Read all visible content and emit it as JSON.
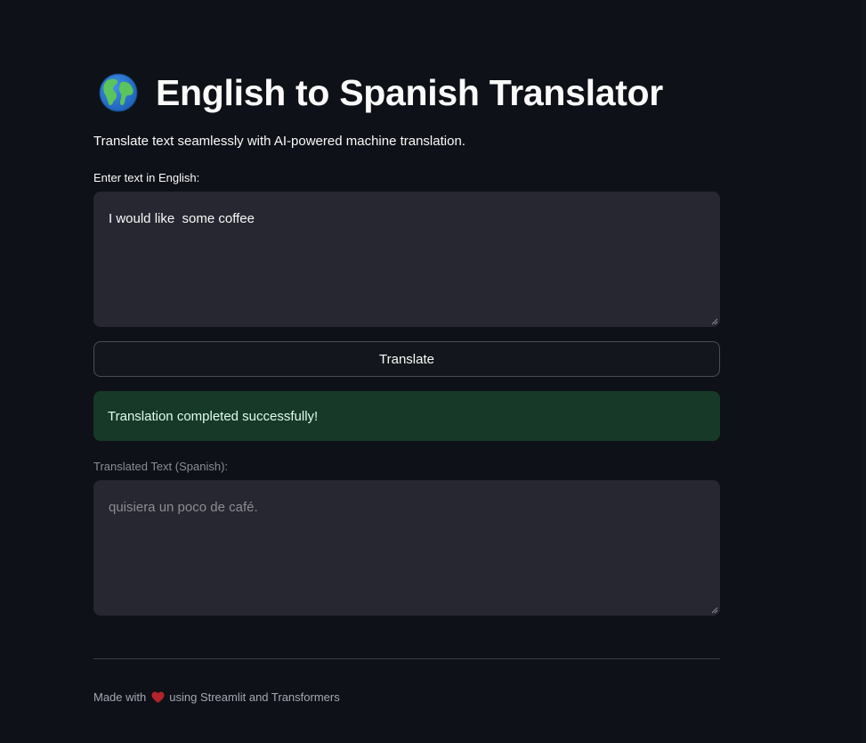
{
  "header": {
    "icon": "globe-icon",
    "title": "English to Spanish Translator",
    "subtitle": "Translate text seamlessly with AI-powered machine translation."
  },
  "input": {
    "label": "Enter text in English:",
    "value": "I would like  some coffee"
  },
  "actions": {
    "translate_label": "Translate"
  },
  "status": {
    "message": "Translation completed successfully!",
    "color": "#173928"
  },
  "output": {
    "label": "Translated Text (Spanish):",
    "value": "quisiera un poco de café."
  },
  "footer": {
    "prefix": "Made with",
    "icon": "heart-icon",
    "suffix": "using Streamlit and Transformers"
  },
  "colors": {
    "background": "#0e1117",
    "field_background": "#262730",
    "text": "#fafafa",
    "heart": "#b3232c"
  }
}
